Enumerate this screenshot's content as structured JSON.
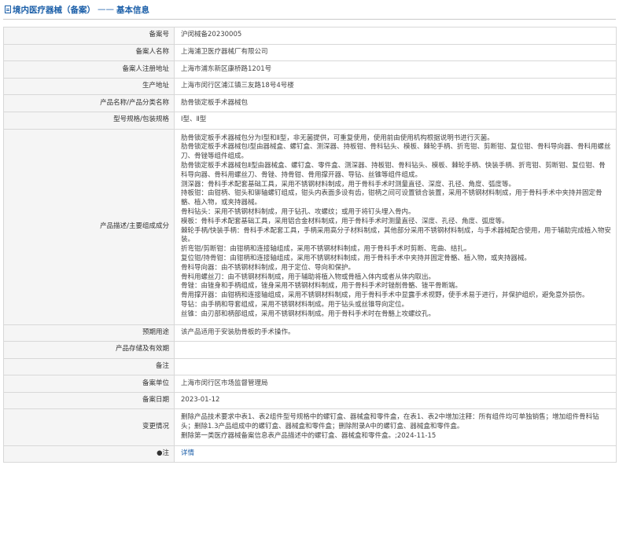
{
  "page": {
    "title_main": "境内医疗器械（备案）",
    "title_sep": "——",
    "title_sub": "基本信息"
  },
  "rows": {
    "record_no": {
      "label": "备案号",
      "value": "沪闵械备20230005"
    },
    "registrant_name": {
      "label": "备案人名称",
      "value": "上海浦卫医疗器械厂有限公司"
    },
    "registrant_address": {
      "label": "备案人注册地址",
      "value": "上海市浦东新区康桥路1201号"
    },
    "production_address": {
      "label": "生产地址",
      "value": "上海市闵行区浦江镇三友路18号4号楼"
    },
    "product_name": {
      "label": "产品名称/产品分类名称",
      "value": "肋骨锁定板手术器械包"
    },
    "model_spec": {
      "label": "型号规格/包装规格",
      "value": "Ⅰ型、Ⅱ型"
    },
    "description": {
      "label": "产品描述/主要组成成分",
      "lines": [
        "肋骨锁定板手术器械包分为Ⅰ型和Ⅱ型，非无菌提供，可重复使用，使用前由使用机构根据说明书进行灭菌。",
        "肋骨锁定板手术器械包Ⅰ型由器械盒、螺钉盒、测深器、持板钳、骨科钻头、模板、棘轮手柄、折弯钳、剪断钳、复位钳、骨科导向器、骨科用螺丝刀、骨锉等组件组成。",
        "肋骨锁定板手术器械包Ⅱ型由器械盒、螺钉盒、零件盒、测深器、持板钳、骨科钻头、模板、棘轮手柄、快装手柄、折弯钳、剪断钳、复位钳、骨科导向器、骨科用螺丝刀、骨锉、持骨钳、骨用撑开器、导钻、丝锥等组件组成。",
        "测深器：骨科手术配套基础工具，采用不锈钢材料制成，用于骨科手术时测量直径、深度、孔径、角度、弧度等。",
        "持板钳：由钳柄、钳头和铆轴螺钉组成，钳头内表面多设有齿，钳柄之间可设置锁合装置，采用不锈钢材料制成，用于骨科手术中夹持并固定骨骼、植入物，或夹持器械。",
        "骨科钻头：采用不锈钢材料制成，用于钻孔、攻螺纹；或用于将钉头埋入骨内。",
        "模板：骨科手术配套基础工具，采用铝合金材料制成，用于骨科手术时测量直径、深度、孔径、角度、弧度等。",
        "棘轮手柄/快装手柄：骨科手术配套工具，手柄采用高分子材料制成，其他部分采用不锈钢材料制成，与手术器械配合使用，用于辅助完成植入物安装。",
        "折弯钳/剪断钳：由钳柄和连接轴组成，采用不锈钢材料制成，用于骨科手术时剪断、弯曲、结扎。",
        "复位钳/持骨钳：由钳柄和连接轴组成，采用不锈钢材料制成，用于骨科手术中夹持并固定骨骼、植入物，或夹持器械。",
        "骨科导向器：由不锈钢材料制成，用于定位、导向和保护。",
        "骨科用螺丝刀：由不锈钢材料制成，用于辅助将植入物或骨植入体内或者从体内取出。",
        "骨锉：由锉身和手柄组成，锉身采用不锈钢材料制成，用于骨科手术时锉削骨骼、锉平骨断端。",
        "骨用撑开器：由钳柄和连接轴组成，采用不锈钢材料制成，用于骨科手术中显露手术视野，使手术易于进行，并保护组织，避免意外损伤。",
        "导钻：由手柄和导套组成，采用不锈钢材料制成。用于钻头或丝锥导向定位。",
        "丝锥：由刃部和柄部组成，采用不锈钢材料制成。用于骨科手术时在骨骼上攻螺纹孔。"
      ]
    },
    "intended_use": {
      "label": "预期用途",
      "value": "该产品适用于安装肋骨板的手术操作。"
    },
    "storage": {
      "label": "产品存储及有效期",
      "value": ""
    },
    "remark": {
      "label": "备注",
      "value": ""
    },
    "record_unit": {
      "label": "备案单位",
      "value": "上海市闵行区市场监督管理局"
    },
    "record_date": {
      "label": "备案日期",
      "value": "2023-01-12"
    },
    "change": {
      "label": "变更情况",
      "lines": [
        "删除产品技术要求中表1、表2组件型号规格中的螺钉盒、器械盒和零件盒，在表1、表2中增加注释：所有组件均可单独销售；增加组件骨科钻头；删除1.3产品组成中的螺钉盒、器械盒和零件盒；删除附录A中的螺钉盒、器械盒和零件盒。",
        "删除第一类医疗器械备案信息表产品描述中的螺钉盒、器械盒和零件盒。;2024-11-15"
      ]
    },
    "note": {
      "label": "●注",
      "value": "详情"
    }
  }
}
